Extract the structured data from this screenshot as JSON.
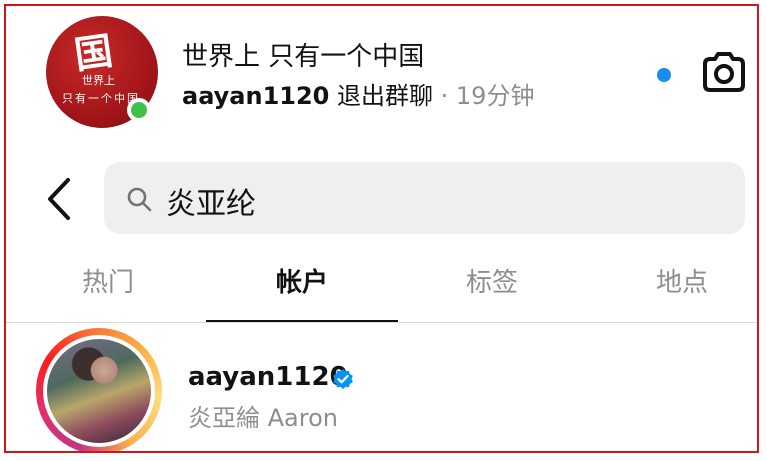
{
  "notification": {
    "group_avatar_lines": [
      "世界上",
      "只有一个中国"
    ],
    "group_name": "世界上 只有一个中国",
    "user": "aayan1120",
    "action": "退出群聊",
    "separator": " · ",
    "time": "19分钟"
  },
  "search": {
    "query": "炎亚纶"
  },
  "tabs": [
    {
      "label": "热门"
    },
    {
      "label": "帐户"
    },
    {
      "label": "标签"
    },
    {
      "label": "地点"
    }
  ],
  "active_tab": "帐户",
  "result": {
    "username": "aayan1120",
    "full_name": "炎亞綸 Aaron",
    "verified": true
  },
  "colors": {
    "frame": "#d0161c",
    "online": "#3fc04a",
    "unread_dot": "#1a8cea",
    "verified": "#0095f6",
    "muted": "#8e8e8e"
  }
}
